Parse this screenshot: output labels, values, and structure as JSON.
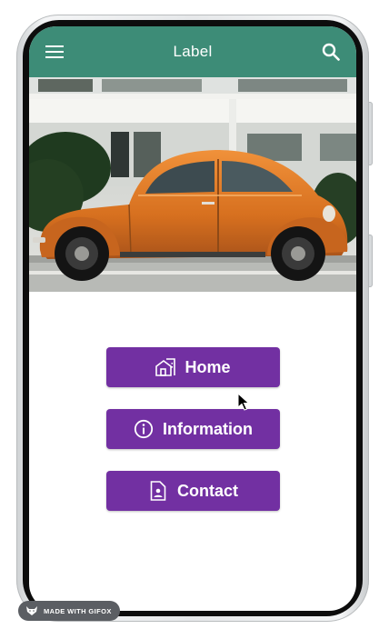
{
  "theme": {
    "app_bar_color": "#3d8c77",
    "button_color": "#7230a2",
    "button_text_color": "#ffffff"
  },
  "app_bar": {
    "title": "Label",
    "menu_icon": "hamburger-menu-icon",
    "search_icon": "search-icon"
  },
  "hero_image": {
    "subject": "orange-vintage-beetle-car-photo"
  },
  "buttons": [
    {
      "label": "Home",
      "icon": "house-icon"
    },
    {
      "label": "Information",
      "icon": "info-circle-icon"
    },
    {
      "label": "Contact",
      "icon": "contact-card-icon"
    }
  ],
  "watermark": {
    "text": "MADE WITH GIFOX",
    "icon": "fox-logo-icon"
  }
}
